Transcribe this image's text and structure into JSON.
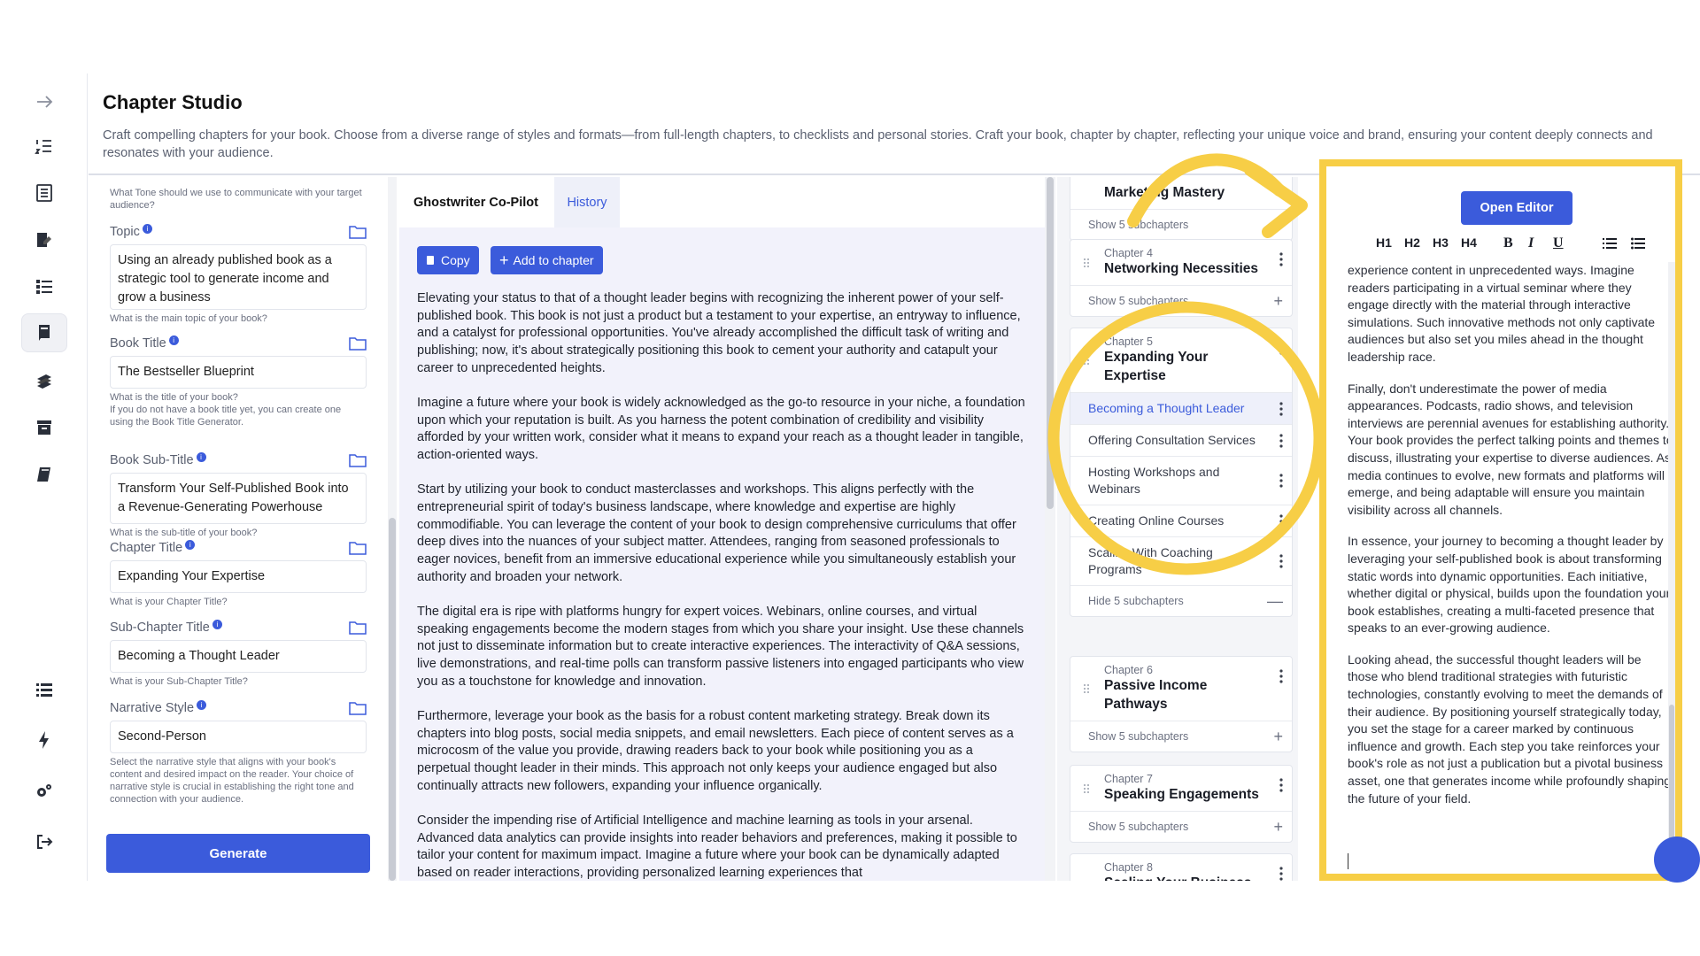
{
  "header": {
    "title": "Chapter Studio",
    "description": "Craft compelling chapters for your book. Choose from a diverse range of styles and formats—from full-length chapters, to checklists and personal stories. Craft your book, chapter by chapter, reflecting your unique voice and brand, ensuring your content deeply connects and resonates with your audience."
  },
  "form": {
    "tone_help": "What Tone should we use to communicate with your target audience?",
    "fields": [
      {
        "label": "Topic",
        "value": "Using an already published book as a strategic tool to generate income and grow a business",
        "help": "What is the main topic of your book?"
      },
      {
        "label": "Book Title",
        "value": "The Bestseller Blueprint",
        "help": "What is the title of your book?",
        "help2": "If you do not have a book title yet, you can create one using the Book Title Generator."
      },
      {
        "label": "Book Sub-Title",
        "value": "Transform Your Self-Published Book into a Revenue-Generating Powerhouse",
        "help": "What is the sub-title of your book?"
      },
      {
        "label": "Chapter Title",
        "value": "Expanding Your Expertise",
        "help": "What is your Chapter Title?"
      },
      {
        "label": "Sub-Chapter Title",
        "value": "Becoming a Thought Leader",
        "help": "What is your Sub-Chapter Title?"
      },
      {
        "label": "Narrative Style",
        "value": "Second-Person",
        "help": "Select the narrative style that aligns with your book's content and desired impact on the reader. Your choice of narrative style is crucial in establishing the right tone and connection with your audience."
      }
    ],
    "generate_label": "Generate"
  },
  "pilot": {
    "tab_ghostwriter": "Ghostwriter Co-Pilot",
    "tab_history": "History",
    "copy_label": "Copy",
    "add_label": "Add to chapter",
    "paragraphs": [
      "Elevating your status to that of a thought leader begins with recognizing the inherent power of your self-published book. This book is not just a product but a testament to your expertise, an entryway to influence, and a catalyst for professional opportunities. You've already accomplished the difficult task of writing and publishing; now, it's about strategically positioning this book to cement your authority and catapult your career to unprecedented heights.",
      "Imagine a future where your book is widely acknowledged as the go-to resource in your niche, a foundation upon which your reputation is built. As you harness the potent combination of credibility and visibility afforded by your written work, consider what it means to expand your reach as a thought leader in tangible, action-oriented ways.",
      "Start by utilizing your book to conduct masterclasses and workshops. This aligns perfectly with the entrepreneurial spirit of today's business landscape, where knowledge and expertise are highly commodifiable. You can leverage the content of your book to design comprehensive curriculums that offer deep dives into the nuances of your subject matter. Attendees, ranging from seasoned professionals to eager novices, benefit from an immersive educational experience while you simultaneously establish your authority and broaden your network.",
      "The digital era is ripe with platforms hungry for expert voices. Webinars, online courses, and virtual speaking engagements become the modern stages from which you share your insight. Use these channels not just to disseminate information but to create interactive experiences. The interactivity of Q&A sessions, live demonstrations, and real-time polls can transform passive listeners into engaged participants who view you as a touchstone for knowledge and innovation.",
      "Furthermore, leverage your book as the basis for a robust content marketing strategy. Break down its chapters into blog posts, social media snippets, and email newsletters. Each piece of content serves as a microcosm of the value you provide, drawing readers back to your book while positioning you as a perpetual thought leader in their minds. This approach not only keeps your audience engaged but also continually attracts new followers, expanding your influence organically.",
      "Consider the impending rise of Artificial Intelligence and machine learning as tools in your arsenal. Advanced data analytics can provide insights into reader behaviors and preferences, making it possible to tailor your content for maximum impact. Imagine a future where your book can be dynamically adapted based on reader interactions, providing personalized learning experiences that"
    ]
  },
  "outline": {
    "top_card": {
      "title": "Marketing Mastery",
      "toggle": "Show 5 subchapters"
    },
    "ch4": {
      "num": "Chapter 4",
      "title": "Networking Necessities",
      "toggle": "Show 5 subchapters"
    },
    "ch5": {
      "num": "Chapter 5",
      "title": "Expanding Your Expertise",
      "toggle": "Hide 5 subchapters",
      "subs": [
        "Becoming a Thought Leader",
        "Offering Consultation Services",
        "Hosting Workshops and Webinars",
        "Creating Online Courses",
        "Scaling With Coaching Programs"
      ]
    },
    "ch6": {
      "num": "Chapter 6",
      "title": "Passive Income Pathways",
      "toggle": "Show 5 subchapters"
    },
    "ch7": {
      "num": "Chapter 7",
      "title": "Speaking Engagements",
      "toggle": "Show 5 subchapters"
    },
    "ch8": {
      "num": "Chapter 8",
      "title": "Scaling Your Business"
    }
  },
  "editor": {
    "open_label": "Open Editor",
    "toolbar": [
      "H1",
      "H2",
      "H3",
      "H4",
      "B",
      "I",
      "U"
    ],
    "paragraphs": [
      "experience content in unprecedented ways. Imagine readers participating in a virtual seminar where they engage directly with the material through interactive simulations. Such innovative methods not only captivate audiences but also set you miles ahead in the thought leadership race.",
      "Finally, don't underestimate the power of media appearances. Podcasts, radio shows, and television interviews are perennial avenues for establishing authority. Your book provides the perfect talking points and themes to discuss, illustrating your expertise to diverse audiences. As media continues to evolve, new formats and platforms will emerge, and being adaptable will ensure you maintain visibility across all channels.",
      "In essence, your journey to becoming a thought leader by leveraging your self-published book is about transforming static words into dynamic opportunities. Each initiative, whether digital or physical, builds upon the foundation your book establishes, creating a multi-faceted presence that speaks to an ever-growing audience.",
      "Looking ahead, the successful thought leaders will be those who blend traditional strategies with futuristic technologies, constantly evolving to meet the demands of their audience. By positioning yourself strategically today, you set the stage for a career marked by continuous influence and growth. Each step you take reinforces your book's role as not just a publication but a pivotal business asset, one that generates income while profoundly shaping the future of your field."
    ]
  },
  "colors": {
    "accent": "#3b5bdb",
    "highlight": "#f7ce46"
  }
}
